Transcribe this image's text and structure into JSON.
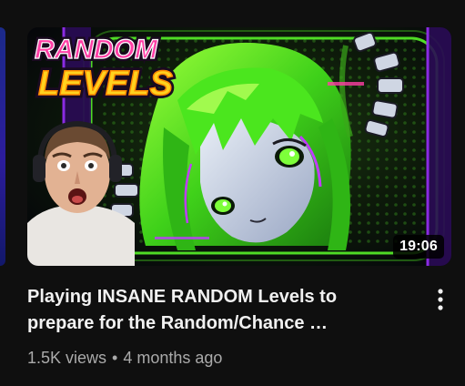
{
  "video": {
    "duration": "19:06",
    "title_line1": "Playing INSANE RANDOM Levels to",
    "title_line2": "prepare for the Random/Chance …",
    "views": "1.5K views",
    "separator": "•",
    "age": "4 months ago"
  },
  "thumbnail_text": {
    "line1": "RANDOM",
    "line2": "LEVELS"
  },
  "icons": {
    "menu": "more-vert-icon"
  },
  "colors": {
    "background": "#0f0f0f",
    "title": "#f1f1f1",
    "meta": "#aaaaaa",
    "thumb_pink": "#ff3ea5",
    "thumb_yellow": "#ffd21f",
    "thumb_green": "#5cff2a",
    "thumb_purple": "#8a2be2"
  }
}
